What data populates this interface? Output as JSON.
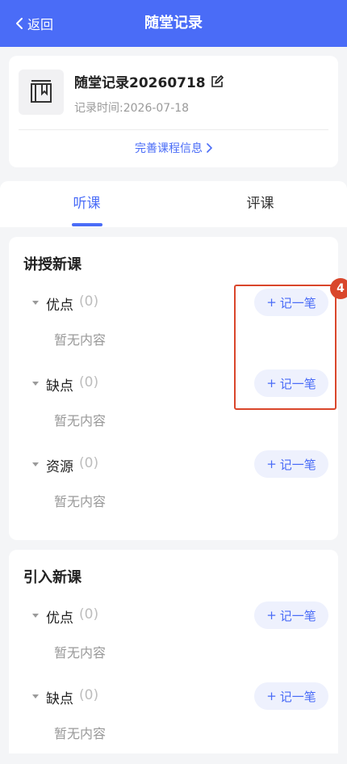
{
  "topbar": {
    "back_label": "返回",
    "title": "随堂记录",
    "background": "#4a6cf7"
  },
  "record": {
    "title": "随堂记录20260718",
    "date_label": "记录时间:",
    "date_value": "2026-07-18",
    "complete_link": "完善课程信息"
  },
  "tabs": [
    {
      "label": "听课",
      "active": true
    },
    {
      "label": "评课",
      "active": false
    }
  ],
  "sections": [
    {
      "title": "讲授新课",
      "items": [
        {
          "label": "优点",
          "count": "(0)",
          "add_label": "记一笔",
          "empty": "暂无内容"
        },
        {
          "label": "缺点",
          "count": "(0)",
          "add_label": "记一笔",
          "empty": "暂无内容"
        },
        {
          "label": "资源",
          "count": "(0)",
          "add_label": "记一笔",
          "empty": "暂无内容"
        }
      ]
    },
    {
      "title": "引入新课",
      "items": [
        {
          "label": "优点",
          "count": "(0)",
          "add_label": "记一笔",
          "empty": "暂无内容"
        },
        {
          "label": "缺点",
          "count": "(0)",
          "add_label": "记一笔",
          "empty": "暂无内容"
        }
      ]
    }
  ],
  "annotation": {
    "badge": "4",
    "color": "#d9462b"
  },
  "colors": {
    "accent": "#4a6cf7",
    "page_bg": "#f4f5f7"
  }
}
